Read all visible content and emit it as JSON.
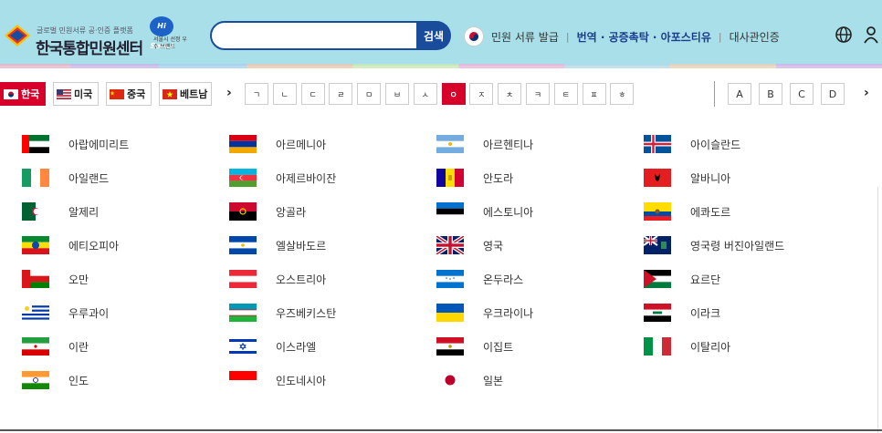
{
  "logo": {
    "badge": "민원",
    "tagline": "글로벌 민원서류 공·인증 플랫폼",
    "title": "한국통합민원센터",
    "seoul_badge": "Hi Seoul",
    "seoul_text": "서울시 선정 우수 브랜드"
  },
  "search": {
    "placeholder": "",
    "value": "",
    "button": "검색"
  },
  "topnav": {
    "issue": "민원 서류 발급",
    "translate": "번역 · 공증촉탁 · 아포스티유",
    "embassy": "대사관인증"
  },
  "languages": [
    {
      "label": "한국",
      "active": true
    },
    {
      "label": "미국",
      "active": false
    },
    {
      "label": "중국",
      "active": false
    },
    {
      "label": "베트남",
      "active": false
    }
  ],
  "hangul_keys": [
    "ㄱ",
    "ㄴ",
    "ㄷ",
    "ㄹ",
    "ㅁ",
    "ㅂ",
    "ㅅ",
    "ㅇ",
    "ㅈ",
    "ㅊ",
    "ㅋ",
    "ㅌ",
    "ㅍ",
    "ㅎ"
  ],
  "active_hangul": "ㅇ",
  "latin_keys": [
    "A",
    "B",
    "C",
    "D"
  ],
  "arrows": {
    "prev": "›",
    "next": "›"
  },
  "countries": [
    {
      "name": "아랍에미리트",
      "flag": "uae-flag"
    },
    {
      "name": "아르메니아",
      "flag": "armenia-flag"
    },
    {
      "name": "아르헨티나",
      "flag": "argentina-flag"
    },
    {
      "name": "아이슬란드",
      "flag": "iceland-flag"
    },
    {
      "name": "아일랜드",
      "flag": "ireland-flag"
    },
    {
      "name": "아제르바이잔",
      "flag": "azerbaijan-flag"
    },
    {
      "name": "안도라",
      "flag": "andorra-flag"
    },
    {
      "name": "알바니아",
      "flag": "albania-flag"
    },
    {
      "name": "알제리",
      "flag": "algeria-flag"
    },
    {
      "name": "앙골라",
      "flag": "angola-flag"
    },
    {
      "name": "에스토니아",
      "flag": "estonia-flag"
    },
    {
      "name": "에콰도르",
      "flag": "ecuador-flag"
    },
    {
      "name": "에티오피아",
      "flag": "ethiopia-flag"
    },
    {
      "name": "엘살바도르",
      "flag": "el-salvador-flag"
    },
    {
      "name": "영국",
      "flag": "uk-flag"
    },
    {
      "name": "영국령 버진아일랜드",
      "flag": "bvi-flag"
    },
    {
      "name": "오만",
      "flag": "oman-flag"
    },
    {
      "name": "오스트리아",
      "flag": "austria-flag"
    },
    {
      "name": "온두라스",
      "flag": "honduras-flag"
    },
    {
      "name": "요르단",
      "flag": "jordan-flag"
    },
    {
      "name": "우루과이",
      "flag": "uruguay-flag"
    },
    {
      "name": "우즈베키스탄",
      "flag": "uzbekistan-flag"
    },
    {
      "name": "우크라이나",
      "flag": "ukraine-flag"
    },
    {
      "name": "이라크",
      "flag": "iraq-flag"
    },
    {
      "name": "이란",
      "flag": "iran-flag"
    },
    {
      "name": "이스라엘",
      "flag": "israel-flag"
    },
    {
      "name": "이집트",
      "flag": "egypt-flag"
    },
    {
      "name": "이탈리아",
      "flag": "italy-flag"
    },
    {
      "name": "인도",
      "flag": "india-flag"
    },
    {
      "name": "인도네시아",
      "flag": "indonesia-flag"
    },
    {
      "name": "일본",
      "flag": "japan-flag"
    }
  ],
  "colors": {
    "header_bg": "#a9dfe8",
    "accent_red": "#d6002a",
    "brand_blue": "#1a4c9c"
  }
}
